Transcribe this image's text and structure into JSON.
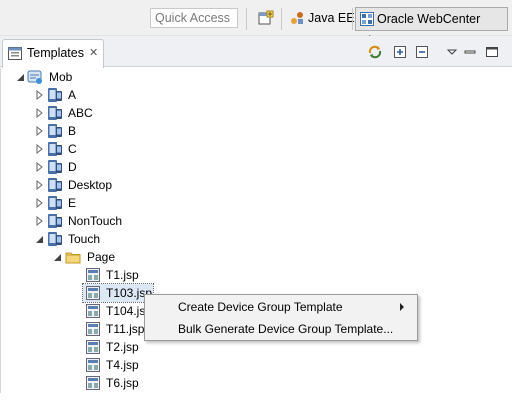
{
  "toolbar": {
    "quick_access_placeholder": "Quick Access",
    "perspectives": [
      {
        "label": "Java EE",
        "icon": "java-ee-icon"
      },
      {
        "label": "Oracle WebCenter Sites",
        "icon": "webcenter-sites-icon",
        "active": true
      }
    ]
  },
  "view": {
    "tab_label": "Templates",
    "close_glyph": "✕",
    "actions": [
      "sync-icon",
      "expand-all-icon",
      "collapse-all-icon",
      "view-menu-icon",
      "minimize-icon",
      "maximize-icon"
    ]
  },
  "tree": {
    "root": "Mob",
    "groups": [
      "A",
      "ABC",
      "B",
      "C",
      "D",
      "Desktop",
      "E",
      "NonTouch"
    ],
    "expanded_group": "Touch",
    "folder": "Page",
    "files": [
      "T1.jsp",
      "T103.jsp",
      "T104.jsp",
      "T11.jsp",
      "T2.jsp",
      "T4.jsp",
      "T6.jsp"
    ],
    "selected_file": "T103.jsp"
  },
  "context_menu": {
    "items": [
      {
        "label": "Create Device Group Template",
        "has_submenu": true
      },
      {
        "label": "Bulk Generate Device Group Template...",
        "has_submenu": false
      }
    ]
  },
  "colors": {
    "toolbar_bg": "#f0f0f0",
    "view_bar_bg": "#eef0f3",
    "selection_bg": "#dde8f5",
    "menu_bg": "#f2f2f2"
  }
}
